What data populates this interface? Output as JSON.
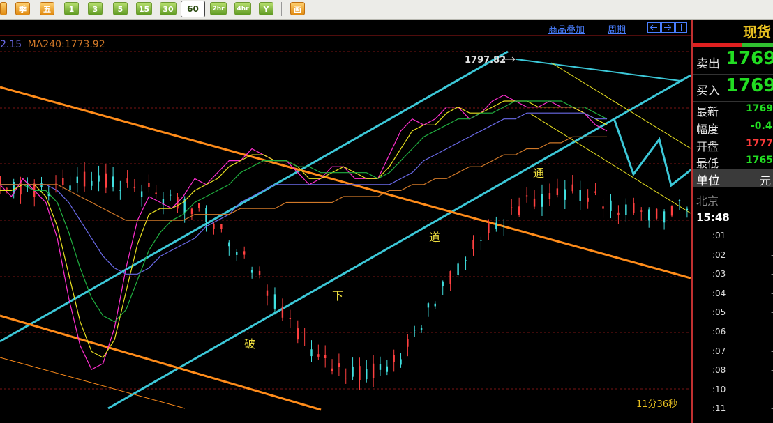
{
  "toolbar": {
    "buttons": [
      "季",
      "五",
      "1",
      "3",
      "5",
      "15",
      "30",
      "60",
      "2hr",
      "4hr",
      "Y",
      "画"
    ],
    "active": "60"
  },
  "header": {
    "overlay_link": "商品叠加",
    "period_link": "周期"
  },
  "indicator": {
    "ma_other_tail": "2.15",
    "ma240_text": "MA240:1773.92"
  },
  "chart_data": {
    "type": "line",
    "title": "",
    "x_axis": "hourly (60-min) bars",
    "ylim": [
      1745,
      1804
    ],
    "grid": "dashed dark red horizontal lines",
    "price_annotations": [
      {
        "label": "1797.82",
        "value": 1797.82
      }
    ],
    "close_path": [
      [
        0,
        1781
      ],
      [
        3,
        1780
      ],
      [
        8,
        1782
      ],
      [
        13,
        1780
      ],
      [
        18,
        1776
      ],
      [
        22,
        1767
      ],
      [
        26,
        1756
      ],
      [
        29,
        1750
      ],
      [
        32,
        1749
      ],
      [
        35,
        1752
      ],
      [
        38,
        1762
      ],
      [
        42,
        1772
      ],
      [
        46,
        1778
      ],
      [
        50,
        1780
      ],
      [
        54,
        1777
      ],
      [
        58,
        1776
      ],
      [
        62,
        1780
      ],
      [
        66,
        1783
      ],
      [
        70,
        1781
      ],
      [
        74,
        1784
      ],
      [
        78,
        1785
      ],
      [
        82,
        1786
      ],
      [
        86,
        1789
      ],
      [
        90,
        1786
      ],
      [
        94,
        1784
      ],
      [
        97,
        1786
      ],
      [
        100,
        1782
      ],
      [
        104,
        1780
      ],
      [
        108,
        1784
      ],
      [
        112,
        1785
      ],
      [
        115,
        1784
      ],
      [
        119,
        1781
      ],
      [
        122,
        1782
      ],
      [
        126,
        1783
      ],
      [
        130,
        1789
      ],
      [
        134,
        1791
      ],
      [
        137,
        1793
      ],
      [
        141,
        1790
      ],
      [
        145,
        1793
      ],
      [
        149,
        1795
      ],
      [
        152,
        1793
      ],
      [
        156,
        1791
      ],
      [
        160,
        1794
      ],
      [
        164,
        1796
      ],
      [
        167,
        1797
      ],
      [
        170,
        1795
      ],
      [
        173,
        1793
      ],
      [
        176,
        1794
      ],
      [
        179,
        1795
      ],
      [
        182,
        1794
      ],
      [
        186,
        1794
      ],
      [
        190,
        1792
      ],
      [
        193,
        1790
      ],
      [
        196,
        1789
      ]
    ],
    "series": [
      {
        "name": "",
        "color": "#ff2fd0",
        "values": [
          1781,
          1779,
          1782,
          1780,
          1778,
          1772,
          1762,
          1754,
          1750,
          1751,
          1757,
          1767,
          1775,
          1779,
          1778,
          1777,
          1779,
          1782,
          1781,
          1783,
          1785,
          1785,
          1787,
          1786,
          1785,
          1785,
          1783,
          1781,
          1782,
          1784,
          1784,
          1782,
          1782,
          1782,
          1786,
          1790,
          1792,
          1791,
          1792,
          1794,
          1794,
          1792,
          1793,
          1795,
          1796,
          1795,
          1794,
          1794,
          1795,
          1794,
          1794,
          1793,
          1791,
          1790
        ]
      },
      {
        "name": "",
        "color": "#e8e020",
        "values": [
          1780,
          1780,
          1781,
          1781,
          1779,
          1774,
          1766,
          1758,
          1753,
          1752,
          1755,
          1763,
          1771,
          1776,
          1777,
          1777,
          1778,
          1780,
          1781,
          1782,
          1784,
          1785,
          1786,
          1786,
          1785,
          1785,
          1784,
          1782,
          1782,
          1783,
          1784,
          1783,
          1782,
          1782,
          1784,
          1787,
          1790,
          1791,
          1791,
          1793,
          1794,
          1793,
          1793,
          1794,
          1795,
          1795,
          1795,
          1794,
          1794,
          1794,
          1794,
          1793,
          1792,
          1791
        ]
      },
      {
        "name": "",
        "color": "#20b040",
        "values": [
          1781,
          1781,
          1781,
          1780,
          1780,
          1778,
          1773,
          1767,
          1762,
          1759,
          1758,
          1760,
          1765,
          1770,
          1773,
          1775,
          1776,
          1778,
          1779,
          1780,
          1781,
          1783,
          1784,
          1785,
          1785,
          1785,
          1784,
          1784,
          1783,
          1783,
          1783,
          1783,
          1783,
          1782,
          1783,
          1785,
          1787,
          1789,
          1790,
          1791,
          1792,
          1792,
          1793,
          1793,
          1794,
          1795,
          1795,
          1795,
          1795,
          1795,
          1794,
          1794,
          1793,
          1792
        ]
      },
      {
        "name": "",
        "color": "#6a6ae8",
        "values": [
          1781,
          1781,
          1781,
          1781,
          1781,
          1780,
          1778,
          1775,
          1772,
          1769,
          1767,
          1766,
          1766,
          1767,
          1769,
          1770,
          1771,
          1772,
          1774,
          1775,
          1776,
          1778,
          1779,
          1780,
          1781,
          1781,
          1781,
          1781,
          1781,
          1781,
          1781,
          1781,
          1781,
          1781,
          1781,
          1782,
          1783,
          1785,
          1786,
          1787,
          1788,
          1789,
          1790,
          1791,
          1792,
          1792,
          1793,
          1793,
          1793,
          1793,
          1793,
          1793,
          1792,
          1792
        ]
      },
      {
        "name": "",
        "color": "#d07828",
        "values": [
          1781,
          1781,
          1781,
          1781,
          1781,
          1781,
          1780,
          1779,
          1778,
          1777,
          1776,
          1775,
          1775,
          1775,
          1775,
          1775,
          1775,
          1776,
          1776,
          1776,
          1776,
          1777,
          1777,
          1777,
          1777,
          1778,
          1778,
          1778,
          1778,
          1778,
          1779,
          1779,
          1779,
          1779,
          1780,
          1780,
          1781,
          1781,
          1782,
          1782,
          1783,
          1784,
          1784,
          1785,
          1786,
          1786,
          1787,
          1787,
          1788,
          1788,
          1789,
          1789,
          1789,
          1789
        ]
      }
    ],
    "annotations": [
      "破",
      "下",
      "道",
      "通"
    ],
    "footer_label": "11分36秒"
  },
  "sidebar": {
    "title": "现货",
    "sell_label": "卖出",
    "sell_value": "1769.",
    "buy_label": "买入",
    "buy_value": "1769.",
    "stats": [
      {
        "label": "最新",
        "value": "1769",
        "color": "#22dd22"
      },
      {
        "label": "幅度",
        "value": "-0.4",
        "color": "#22dd22"
      },
      {
        "label": "开盘",
        "value": "1777",
        "color": "#ff3b3b"
      },
      {
        "label": "最低",
        "value": "1765",
        "color": "#22dd22"
      }
    ],
    "unit_label": "单位",
    "unit_value": "元",
    "location": "北京",
    "time": "15:48",
    "ticks": [
      ":01",
      ":02",
      ":03",
      ":04",
      ":05",
      ":06",
      ":07",
      ":08",
      ":10",
      ":11"
    ]
  }
}
